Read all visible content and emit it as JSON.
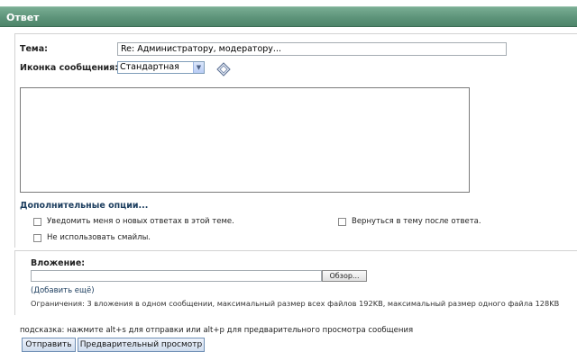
{
  "header": {
    "title": "Ответ"
  },
  "form": {
    "subject_label": "Тема:",
    "subject_value": "Re: Администратору, модератору...",
    "icon_label": "Иконка сообщения:",
    "icon_selected": "Стандартная",
    "icon_preview": "diamond-icon"
  },
  "options": {
    "title": "Дополнительные опции...",
    "notify_label": "Уведомить меня о новых ответах в этой теме.",
    "return_label": "Вернуться в тему после ответа.",
    "no_smilies_label": "Не использовать смайлы."
  },
  "attachment": {
    "label": "Вложение:",
    "browse_label": "Обзор...",
    "add_more": "(Добавить ещё)",
    "limits": "Ограничения: 3 вложения в одном сообщении, максимальный размер всех файлов 192KB, максимальный размер одного файла 128KB"
  },
  "footer": {
    "hint": "подсказка: нажмите alt+s для отправки или alt+p для предварительного просмотра сообщения",
    "submit_label": "Отправить",
    "preview_label": "Предварительный просмотр"
  }
}
